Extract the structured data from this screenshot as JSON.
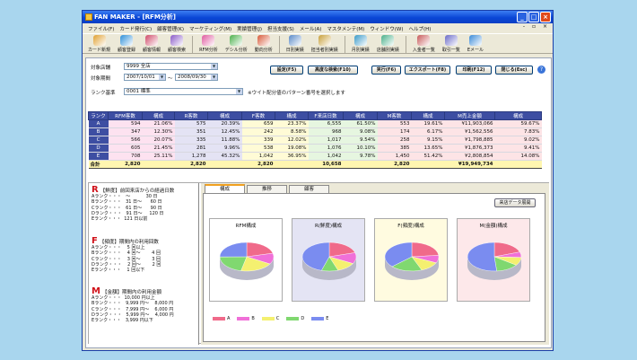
{
  "window": {
    "title": "FAN MAKER - [RFM分析]",
    "btn_min": "_",
    "btn_max": "□",
    "btn_close": "×",
    "mdi": "- ▫ ×"
  },
  "menu": [
    "ファイル(F)",
    "カード発行(C)",
    "顧客管理(K)",
    "マーケティング(M)",
    "実績管理(J)",
    "担当支援(S)",
    "メール(A)",
    "マスタメンテ(M)",
    "ウィンドウ(W)",
    "ヘルプ(H)"
  ],
  "toolbar": [
    {
      "label": "カード新規",
      "icon": "card-icon",
      "color": "#e0a030"
    },
    {
      "label": "顧客登録",
      "icon": "customer-add-icon",
      "color": "#2e8fd8"
    },
    {
      "label": "顧客情報",
      "icon": "customer-info-icon",
      "color": "#d04a6a"
    },
    {
      "label": "顧客検索",
      "icon": "customer-search-icon",
      "color": "#8a5ac8"
    },
    {
      "label": "RFM分析",
      "icon": "rfm-chart-icon",
      "color": "#e05aa0"
    },
    {
      "label": "デシル分析",
      "icon": "decile-chart-icon",
      "color": "#4ab04a"
    },
    {
      "label": "動向分析",
      "icon": "trend-chart-icon",
      "color": "#d85a3a"
    },
    {
      "label": "日別実績",
      "icon": "calendar-icon",
      "color": "#5a8ac8"
    },
    {
      "label": "担当者別実績",
      "icon": "staff-report-icon",
      "color": "#c8a03a"
    },
    {
      "label": "月別実績",
      "icon": "monthly-report-icon",
      "color": "#3a9ac8"
    },
    {
      "label": "店舗別実績",
      "icon": "store-icon",
      "color": "#4ab08a"
    },
    {
      "label": "入金者一覧",
      "icon": "payment-list-icon",
      "color": "#c85a5a"
    },
    {
      "label": "取引一覧",
      "icon": "transaction-list-icon",
      "color": "#6a6ac8"
    },
    {
      "label": "Eメール",
      "icon": "email-icon",
      "color": "#3a8ad8"
    }
  ],
  "filters": {
    "store_label": "対象店舗",
    "store_value": "9999 全店",
    "period_label": "対象期間",
    "date_from": "2007/10/01",
    "tilde": "～",
    "date_to": "2008/09/30",
    "rank_label": "ランク基準",
    "rank_value": "0001 標準",
    "note": "※ウイト配分値のパターン番号を選択します"
  },
  "buttons": {
    "settings": "設定(F5)",
    "advanced": "高度な検索(F10)",
    "run": "実行(F6)",
    "export": "エクスポート(F8)",
    "print": "印刷(F12)",
    "close": "閉じる(Esc)",
    "help": "?"
  },
  "table": {
    "headers": [
      "ランク",
      "RFM客数",
      "構成",
      "R客数",
      "構成",
      "F客数",
      "構成",
      "F来店日数",
      "構成",
      "M客数",
      "構成",
      "M売上金額",
      "構成"
    ],
    "rows": [
      [
        "A",
        "594",
        "21.06%",
        "575",
        "20.39%",
        "659",
        "23.37%",
        "6,555",
        "61.50%",
        "553",
        "19.61%",
        "¥11,903,066",
        "59.67%"
      ],
      [
        "B",
        "347",
        "12.30%",
        "351",
        "12.45%",
        "242",
        "8.58%",
        "968",
        "9.08%",
        "174",
        "6.17%",
        "¥1,562,556",
        "7.83%"
      ],
      [
        "C",
        "566",
        "20.07%",
        "335",
        "11.88%",
        "339",
        "12.02%",
        "1,017",
        "9.54%",
        "258",
        "9.15%",
        "¥1,798,885",
        "9.02%"
      ],
      [
        "D",
        "605",
        "21.45%",
        "281",
        "9.96%",
        "538",
        "19.08%",
        "1,076",
        "10.10%",
        "385",
        "13.65%",
        "¥1,876,373",
        "9.41%"
      ],
      [
        "E",
        "708",
        "25.11%",
        "1,278",
        "45.32%",
        "1,042",
        "36.95%",
        "1,042",
        "9.78%",
        "1,450",
        "51.42%",
        "¥2,808,854",
        "14.08%"
      ]
    ],
    "total": [
      "合計",
      "2,820",
      "",
      "2,820",
      "",
      "2,820",
      "",
      "10,658",
      "",
      "2,820",
      "",
      "¥19,949,734",
      ""
    ]
  },
  "criteria": {
    "r": {
      "letter": "R",
      "title": "【鮮度】前回来店からの経過日数",
      "rows": [
        "Aランク・・・   ～           30 日",
        "Bランク・・・   31 日～      60 日",
        "Cランク・・・   61 日～      90 日",
        "Dランク・・・   91 日～     120 日",
        "Eランク・・・  121 日以前"
      ]
    },
    "f": {
      "letter": "F",
      "title": "【頻度】期間内の利用回数",
      "rows": [
        "Aランク・・・    5 回以上",
        "Bランク・・・    4 回～        4 回",
        "Cランク・・・    3 回～        3 回",
        "Dランク・・・    2 回～        2 回",
        "Eランク・・・    1 回以下"
      ]
    },
    "m": {
      "letter": "M",
      "title": "【金額】期間内の利用金額",
      "rows": [
        "Aランク・・・  10,000 円以上",
        "Bランク・・・   9,999 円～    8,000 円",
        "Cランク・・・   7,999 円～    6,000 円",
        "Dランク・・・   5,999 円～    4,000 円",
        "Eランク・・・   3,999 円以下"
      ]
    }
  },
  "tabs": [
    "構成",
    "推移",
    "顧客"
  ],
  "expand_button": "来店データ展開",
  "chart_data": [
    {
      "type": "pie",
      "title": "RFM構成",
      "categories": [
        "A",
        "B",
        "C",
        "D",
        "E"
      ],
      "values": [
        21.06,
        12.3,
        20.07,
        21.45,
        25.11
      ]
    },
    {
      "type": "pie",
      "title": "R(鮮度)構成",
      "categories": [
        "A",
        "B",
        "C",
        "D",
        "E"
      ],
      "values": [
        20.39,
        12.45,
        11.88,
        9.96,
        45.32
      ]
    },
    {
      "type": "pie",
      "title": "F(頻度)構成",
      "categories": [
        "A",
        "B",
        "C",
        "D",
        "E"
      ],
      "values": [
        23.37,
        8.58,
        12.02,
        19.08,
        36.95
      ]
    },
    {
      "type": "pie",
      "title": "M(金額)構成",
      "categories": [
        "A",
        "B",
        "C",
        "D",
        "E"
      ],
      "values": [
        19.61,
        6.17,
        9.15,
        13.65,
        51.42
      ]
    }
  ],
  "pie_colors": [
    "#f06a8a",
    "#f070d8",
    "#f4f070",
    "#80d870",
    "#7a8cf0"
  ],
  "pane_colors": [
    "#ffffff",
    "#e4e4f4",
    "#fffbe0",
    "#fde8ea"
  ],
  "legend_labels": [
    "A",
    "B",
    "C",
    "D",
    "E"
  ]
}
